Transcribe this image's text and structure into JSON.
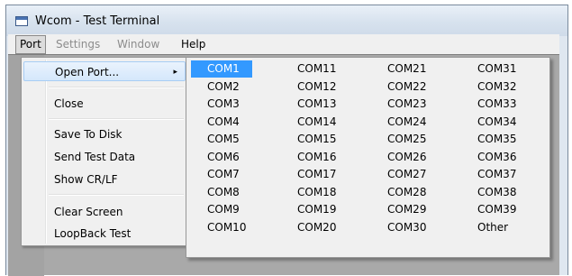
{
  "window": {
    "title": "Wcom - Test Terminal"
  },
  "menubar": {
    "items": [
      {
        "label": "Port",
        "enabled": true,
        "active": true
      },
      {
        "label": "Settings",
        "enabled": false
      },
      {
        "label": "Window",
        "enabled": false
      },
      {
        "label": "Help",
        "enabled": true
      }
    ]
  },
  "port_menu": {
    "items": [
      {
        "label": "Open Port...",
        "submenu": true,
        "highlighted": true
      },
      {
        "label": "Close"
      },
      {
        "label": "Save To Disk"
      },
      {
        "label": "Send Test Data"
      },
      {
        "label": "Show CR/LF"
      },
      {
        "label": "Clear Screen"
      },
      {
        "label": "LoopBack Test"
      }
    ],
    "submenu_arrow": "▸"
  },
  "com_menu": {
    "selected": "COM1",
    "columns": [
      [
        "COM1",
        "COM2",
        "COM3",
        "COM4",
        "COM5",
        "COM6",
        "COM7",
        "COM8",
        "COM9",
        "COM10"
      ],
      [
        "COM11",
        "COM12",
        "COM13",
        "COM14",
        "COM15",
        "COM16",
        "COM17",
        "COM18",
        "COM19",
        "COM20"
      ],
      [
        "COM21",
        "COM22",
        "COM23",
        "COM24",
        "COM25",
        "COM26",
        "COM27",
        "COM28",
        "COM29",
        "COM30"
      ],
      [
        "COM31",
        "COM32",
        "COM33",
        "COM34",
        "COM35",
        "COM36",
        "COM37",
        "COM38",
        "COM39",
        "Other"
      ]
    ]
  },
  "colors": {
    "selection": "#3399ff",
    "menu_background": "#f0f0f0",
    "client_background": "#a9a9a9"
  }
}
